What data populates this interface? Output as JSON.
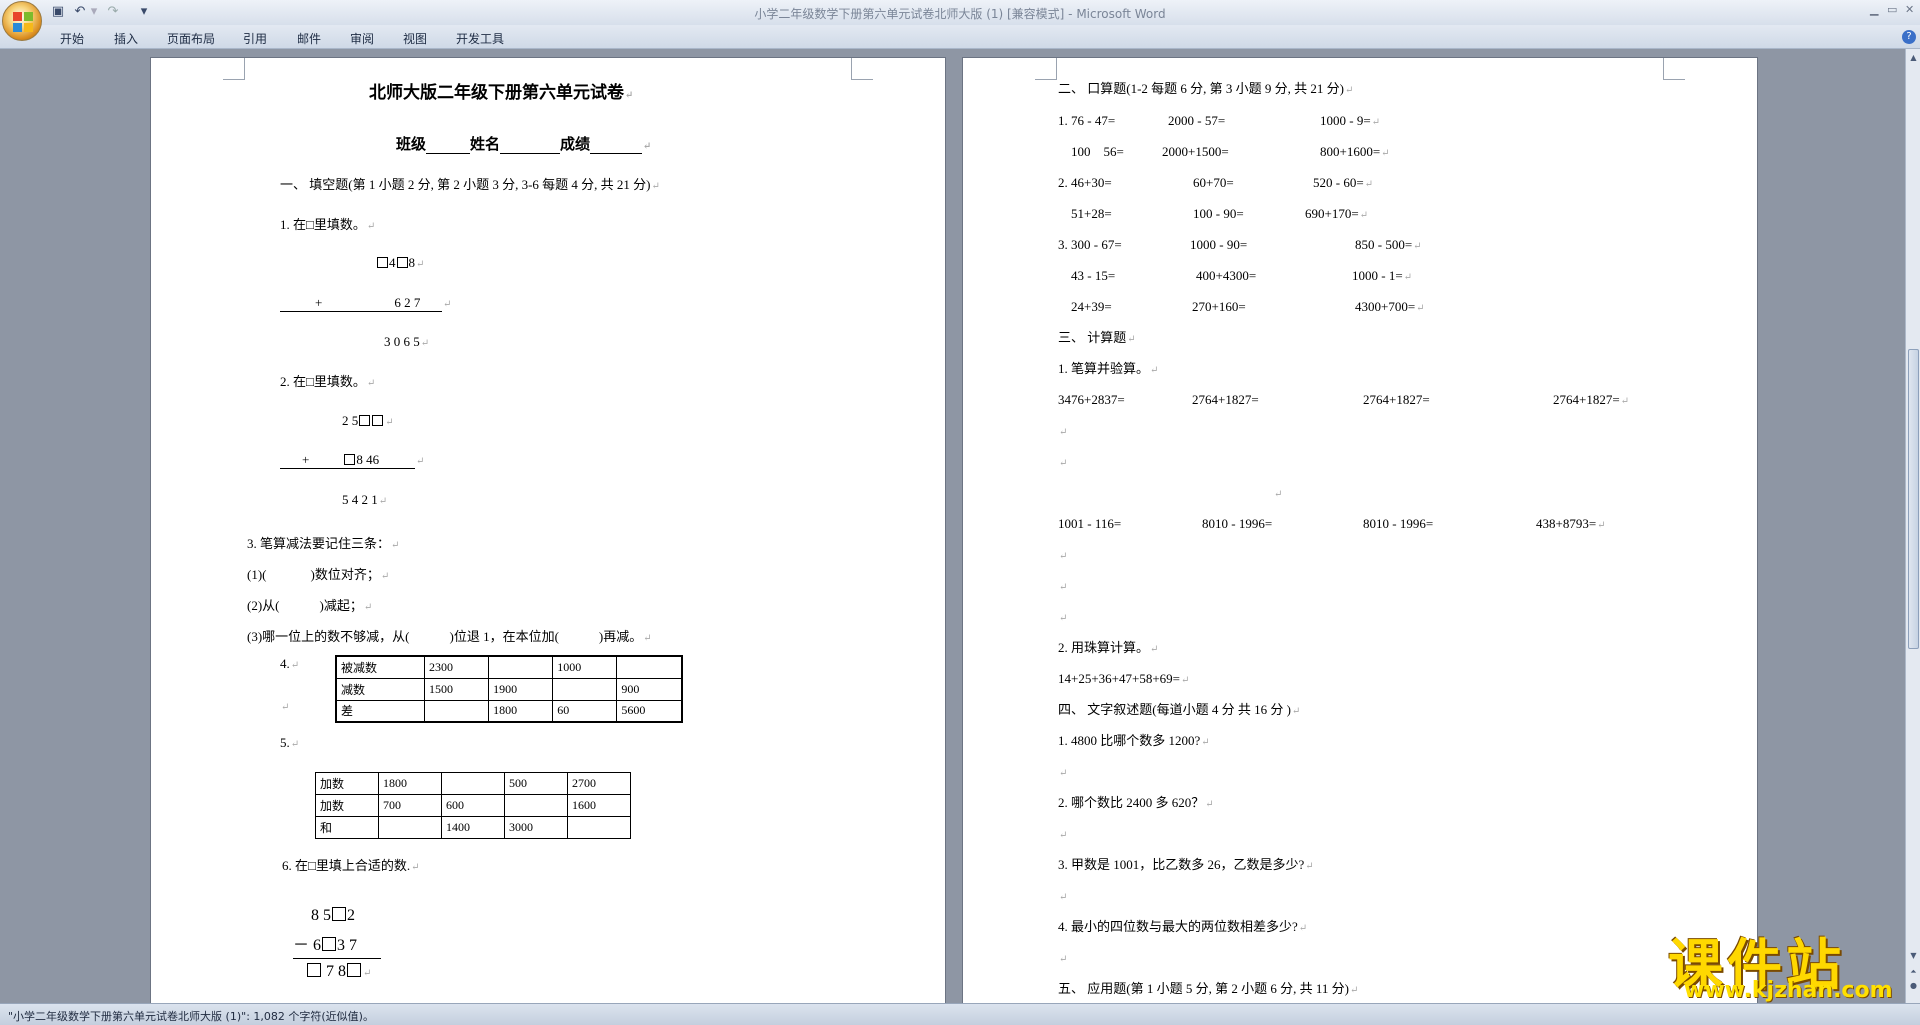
{
  "window": {
    "title": "小学二年级数学下册第六单元试卷北师大版 (1) [兼容模式] - Microsoft Word",
    "min": "▁",
    "max": "▭",
    "close": "✕"
  },
  "ribbon_tabs": [
    "开始",
    "插入",
    "页面布局",
    "引用",
    "邮件",
    "审阅",
    "视图",
    "开发工具"
  ],
  "icons": {
    "office": "office-logo-icon",
    "save": "save-icon",
    "undo": "undo-icon",
    "redo": "redo-icon",
    "help": "help-icon"
  },
  "page1": {
    "title": "北师大版二年级下册第六单元试卷",
    "info": {
      "class": "班级",
      "name": "姓名",
      "score": "成绩"
    },
    "sec1": "一、 填空题(第 1 小题 2 分, 第 2 小题 3 分, 3-6 每题 4 分, 共 21 分)",
    "q1": "1. 在□里填数。",
    "q1_a": "4",
    "q1_b": "8",
    "q1_plus": "+",
    "q1_c": "6 2 7",
    "q1_d": "3 0 6 5",
    "q2": "2. 在□里填数。",
    "q2_a": "2 5",
    "q2_plus": "+",
    "q2_b": "8 46",
    "q2_c": "5 4 2 1",
    "q3": "3. 笔算减法要记住三条：",
    "q3_1a": "(1)(",
    "q3_1b": ")数位对齐；",
    "q3_2a": "(2)从(",
    "q3_2b": ")减起；",
    "q3_3a": "(3)哪一位上的数不够减，从(",
    "q3_3b": ")位退 1，在本位加(",
    "q3_3c": ")再减。",
    "q4": "4.",
    "table4": [
      [
        "被减数",
        "2300",
        "",
        "1000",
        ""
      ],
      [
        "减数",
        "1500",
        "1900",
        "",
        "900"
      ],
      [
        "差",
        "",
        "1800",
        "60",
        "5600"
      ]
    ],
    "q5": "5.",
    "table5": [
      [
        "加数",
        "1800",
        "",
        "500",
        "2700"
      ],
      [
        "加数",
        "700",
        "600",
        "",
        "1600"
      ],
      [
        "和",
        "",
        "1400",
        "3000",
        ""
      ]
    ],
    "q6": "6. 在□里填上合适的数.",
    "q6_a": "8 5",
    "q6_a2": "2",
    "q6_minus": "－",
    "q6_b": "6",
    "q6_b2": "3 7",
    "q6_c": "7 8"
  },
  "page2": {
    "sec2": "二、 口算题(1-2 每题 6 分, 第 3 小题 9 分, 共 21 分)",
    "rows": [
      [
        "1. 76 - 47=",
        "2000 - 57=",
        "1000 - 9="
      ],
      [
        "100    56=",
        "2000+1500=",
        "800+1600="
      ],
      [
        "2. 46+30=",
        "60+70=",
        "520 - 60="
      ],
      [
        "51+28=",
        "100 - 90=",
        "690+170="
      ],
      [
        "3. 300 - 67=",
        "1000 - 90=",
        "850 - 500="
      ],
      [
        "43 - 15=",
        "400+4300=",
        "1000 - 1="
      ],
      [
        "24+39=",
        "270+160=",
        "4300+700="
      ]
    ],
    "sec3": "三、 计算题",
    "c1": "1. 笔算并验算。",
    "calc1": [
      "3476+2837=",
      "2764+1827=",
      "2764+1827=",
      "2764+1827="
    ],
    "calc2": [
      "1001 - 116=",
      "8010 - 1996=",
      "8010 - 1996=",
      "438+8793="
    ],
    "c2": "2. 用珠算计算。",
    "c2_expr": "14+25+36+47+58+69=",
    "sec4": "四、 文字叙述题(每道小题 4 分 共 16 分 )",
    "w1": "1. 4800 比哪个数多 1200?",
    "w2": "2. 哪个数比 2400 多 620？",
    "w3": "3. 甲数是 1001，比乙数多 26，乙数是多少?",
    "w4": "4. 最小的四位数与最大的两位数相差多少?",
    "sec5": "五、 应用题(第 1 小题 5 分, 第 2 小题 6 分, 共 11 分)"
  },
  "para_mark": "↵",
  "status": "\"小学二年级数学下册第六单元试卷北师大版 (1)\": 1,082 个字符(近似值)。",
  "watermark": {
    "cn": "课件站",
    "url": "www.kjzhan.com"
  }
}
